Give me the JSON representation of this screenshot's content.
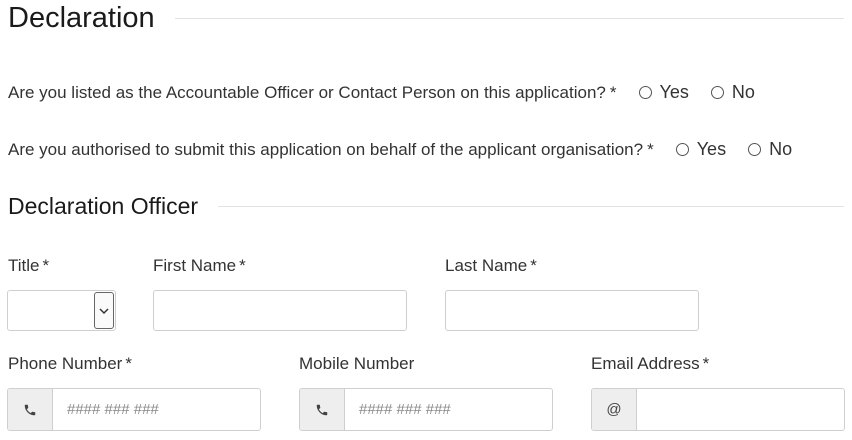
{
  "declaration": {
    "title": "Declaration",
    "questions": [
      {
        "text": "Are you listed as the Accountable Officer or Contact Person on this application?",
        "required": "*",
        "options": [
          "Yes",
          "No"
        ]
      },
      {
        "text": "Are you authorised to submit this application on behalf of the applicant organisation?",
        "required": "*",
        "options": [
          "Yes",
          "No"
        ]
      }
    ]
  },
  "officer": {
    "title": "Declaration Officer",
    "fields": {
      "title": {
        "label": "Title",
        "required": "*",
        "value": ""
      },
      "first_name": {
        "label": "First Name",
        "required": "*",
        "value": ""
      },
      "last_name": {
        "label": "Last Name",
        "required": "*",
        "value": ""
      },
      "phone": {
        "label": "Phone Number",
        "required": "*",
        "placeholder": "#### ### ###",
        "addon_icon": "phone-icon"
      },
      "mobile": {
        "label": "Mobile Number",
        "placeholder": "#### ### ###",
        "addon_icon": "phone-icon"
      },
      "email": {
        "label": "Email Address",
        "required": "*",
        "addon_text": "@",
        "value": ""
      }
    }
  }
}
